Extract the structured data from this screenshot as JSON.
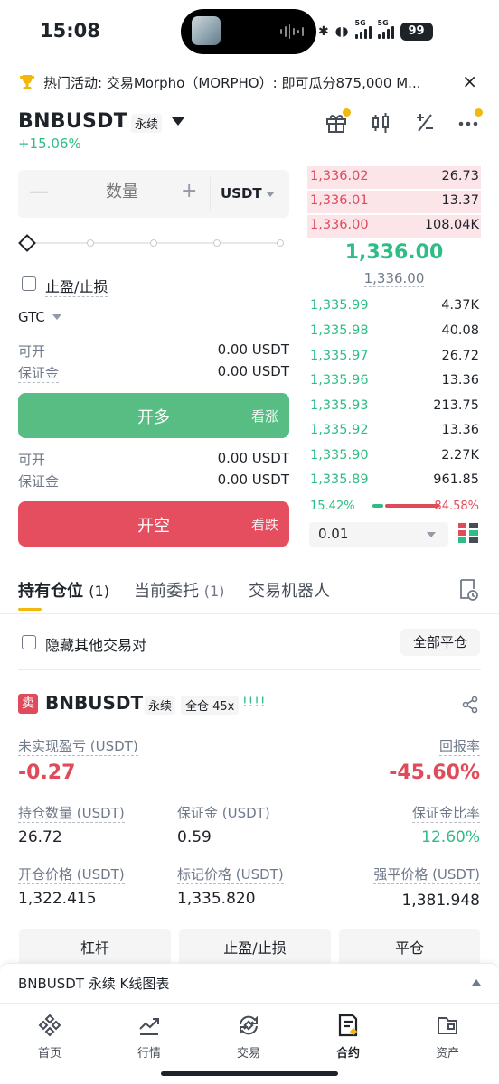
{
  "status_bar": {
    "time": "15:08",
    "network": "5G",
    "network2": "5G",
    "battery": "99"
  },
  "banner": {
    "text": "热门活动: 交易Morpho（MORPHO）: 即可瓜分875,000 M...",
    "close": "×"
  },
  "header": {
    "symbol": "BNBUSDT",
    "type": "永续",
    "change": "+15.06%"
  },
  "order_form": {
    "qty_placeholder": "数量",
    "minus": "—",
    "plus": "+",
    "unit": "USDT",
    "tpsl_label": "止盈/止损",
    "tif": "GTC",
    "long_available_label": "可开",
    "long_available_value": "0.00 USDT",
    "long_margin_label": "保证金",
    "long_margin_value": "0.00 USDT",
    "long_button": "开多",
    "long_sub": "看涨",
    "short_available_label": "可开",
    "short_available_value": "0.00 USDT",
    "short_margin_label": "保证金",
    "short_margin_value": "0.00 USDT",
    "short_button": "开空",
    "short_sub": "看跌"
  },
  "order_book": {
    "asks": [
      {
        "price": "1,336.02",
        "qty": "26.73"
      },
      {
        "price": "1,336.01",
        "qty": "13.37"
      },
      {
        "price": "1,336.00",
        "qty": "108.04K"
      }
    ],
    "mid_price": "1,336.00",
    "mark_price": "1,336.00",
    "bids": [
      {
        "price": "1,335.99",
        "qty": "4.37K"
      },
      {
        "price": "1,335.98",
        "qty": "40.08"
      },
      {
        "price": "1,335.97",
        "qty": "26.72"
      },
      {
        "price": "1,335.96",
        "qty": "13.36"
      },
      {
        "price": "1,335.93",
        "qty": "213.75"
      },
      {
        "price": "1,335.92",
        "qty": "13.36"
      },
      {
        "price": "1,335.90",
        "qty": "2.27K"
      },
      {
        "price": "1,335.89",
        "qty": "961.85"
      }
    ],
    "buy_ratio": "15.42%",
    "sell_ratio": "84.58%",
    "precision": "0.01"
  },
  "tabs": {
    "positions": "持有仓位",
    "positions_count": "(1)",
    "orders": "当前委托",
    "orders_count": "(1)",
    "bots": "交易机器人"
  },
  "positions_controls": {
    "hide_label": "隐藏其他交易对",
    "close_all": "全部平仓"
  },
  "position": {
    "side_tag": "卖",
    "symbol": "BNBUSDT",
    "type": "永续",
    "margin_mode": "全仓 45x",
    "bars": "!!!!",
    "unrealized_pnl_label": "未实现盈亏 (USDT)",
    "unrealized_pnl": "-0.27",
    "roe_label": "回报率",
    "roe": "-45.60%",
    "size_label": "持仓数量 (USDT)",
    "size": "26.72",
    "margin_label": "保证金 (USDT)",
    "margin": "0.59",
    "margin_ratio_label": "保证金比率",
    "margin_ratio": "12.60%",
    "entry_label": "开仓价格 (USDT)",
    "entry": "1,322.415",
    "mark_label": "标记价格 (USDT)",
    "mark": "1,335.820",
    "liq_label": "强平价格 (USDT)",
    "liq": "1,381.948",
    "actions": {
      "leverage": "杠杆",
      "tpsl": "止盈/止损",
      "close": "平仓"
    }
  },
  "kline_bar": {
    "label": "BNBUSDT 永续 K线图表"
  },
  "bottom_nav": [
    {
      "label": "首页",
      "icon": "home-icon"
    },
    {
      "label": "行情",
      "icon": "markets-icon"
    },
    {
      "label": "交易",
      "icon": "trade-icon"
    },
    {
      "label": "合约",
      "icon": "futures-icon"
    },
    {
      "label": "资产",
      "icon": "wallet-icon"
    }
  ],
  "colors": {
    "up": "#2ebd85",
    "down": "#e04b5b",
    "accent": "#f0b90b"
  }
}
